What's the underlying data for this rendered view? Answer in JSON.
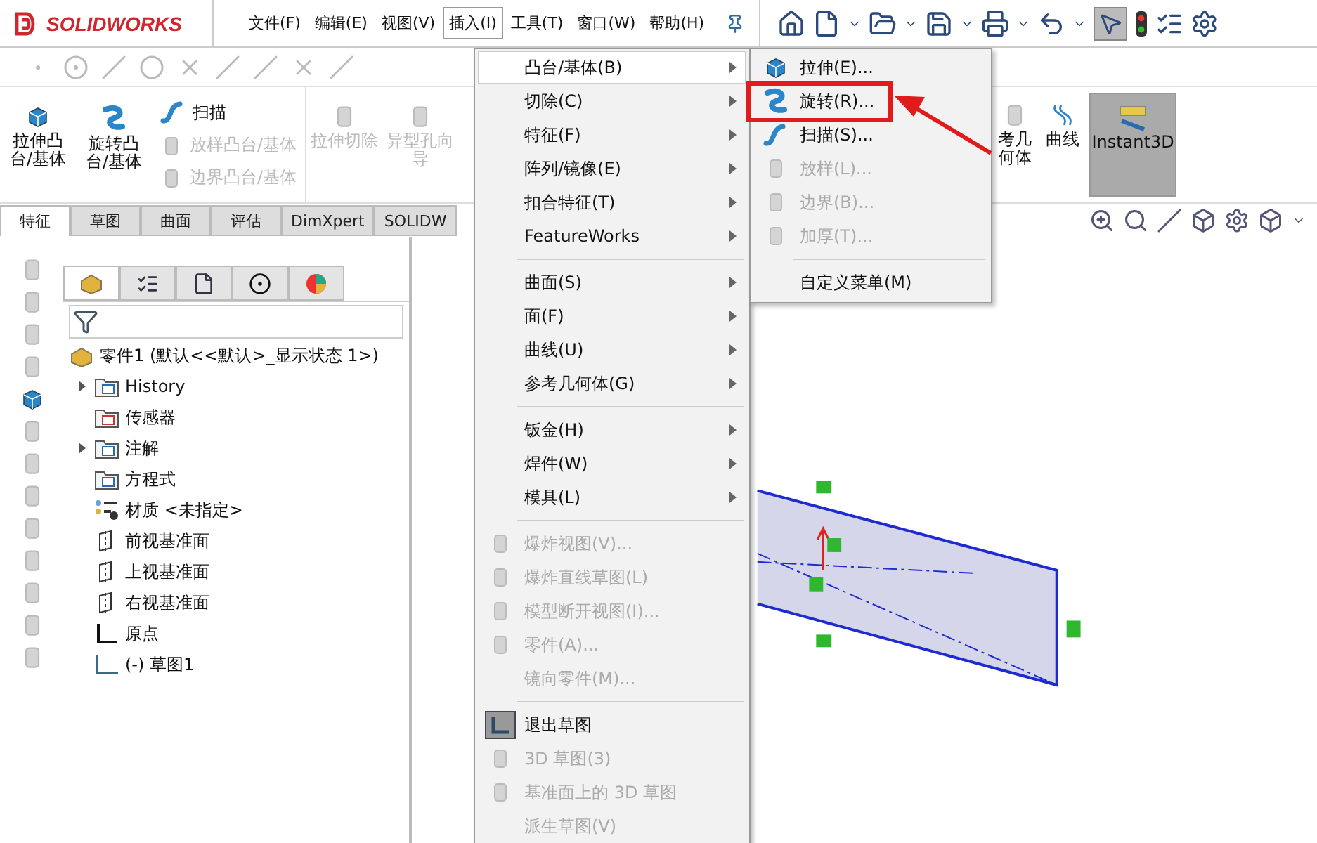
{
  "app": {
    "logo": "SOLIDWORKS"
  },
  "menubar": [
    {
      "label": "文件(F)",
      "selected": false
    },
    {
      "label": "编辑(E)",
      "selected": false
    },
    {
      "label": "视图(V)",
      "selected": false
    },
    {
      "label": "插入(I)",
      "selected": true
    },
    {
      "label": "工具(T)",
      "selected": false
    },
    {
      "label": "窗口(W)",
      "selected": false
    },
    {
      "label": "帮助(H)",
      "selected": false
    }
  ],
  "ribbon": {
    "large": [
      {
        "label": "拉伸凸台/基体",
        "disabled": false
      },
      {
        "label": "旋转凸台/基体",
        "disabled": false
      }
    ],
    "small": [
      {
        "label": "扫描",
        "disabled": false
      },
      {
        "label": "放样凸台/基体",
        "disabled": true
      },
      {
        "label": "边界凸台/基体",
        "disabled": true
      }
    ],
    "cut": [
      {
        "label": "拉伸切除",
        "disabled": true
      },
      {
        "label": "异型孔向导",
        "disabled": true
      }
    ],
    "right": [
      {
        "label": "考几何体",
        "selected": false
      },
      {
        "label": "曲线",
        "selected": false
      },
      {
        "label": "Instant3D",
        "selected": true
      }
    ]
  },
  "tabs": [
    {
      "label": "特征",
      "selected": true
    },
    {
      "label": "草图",
      "selected": false
    },
    {
      "label": "曲面",
      "selected": false
    },
    {
      "label": "评估",
      "selected": false
    },
    {
      "label": "DimXpert",
      "selected": false
    },
    {
      "label": "SOLIDW",
      "selected": false
    }
  ],
  "panel_tabs": [
    {
      "selected": true
    },
    {
      "selected": false
    },
    {
      "selected": false
    },
    {
      "selected": false
    },
    {
      "selected": false
    }
  ],
  "tree": {
    "root": "零件1  (默认<<默认>_显示状态 1>)",
    "items": [
      {
        "label": "History",
        "kind": "history",
        "expandable": true
      },
      {
        "label": "传感器",
        "kind": "sensor",
        "expandable": false
      },
      {
        "label": "注解",
        "kind": "annotation",
        "expandable": true
      },
      {
        "label": "方程式",
        "kind": "equation",
        "expandable": false
      },
      {
        "label": "材质 <未指定>",
        "kind": "material",
        "expandable": false
      },
      {
        "label": "前视基准面",
        "kind": "plane",
        "expandable": false
      },
      {
        "label": "上视基准面",
        "kind": "plane",
        "expandable": false
      },
      {
        "label": "右视基准面",
        "kind": "plane",
        "expandable": false
      },
      {
        "label": "原点",
        "kind": "origin",
        "expandable": false
      },
      {
        "label": "(-) 草图1",
        "kind": "sketch",
        "expandable": false
      }
    ]
  },
  "insert_menu": {
    "items": [
      {
        "kind": "submenu",
        "label": "凸台/基体(B)",
        "selected": true,
        "disabled": false
      },
      {
        "kind": "submenu",
        "label": "切除(C)",
        "selected": false,
        "disabled": false
      },
      {
        "kind": "submenu",
        "label": "特征(F)",
        "selected": false,
        "disabled": false
      },
      {
        "kind": "submenu",
        "label": "阵列/镜像(E)",
        "selected": false,
        "disabled": false
      },
      {
        "kind": "submenu",
        "label": "扣合特征(T)",
        "selected": false,
        "disabled": false
      },
      {
        "kind": "submenu",
        "label": "FeatureWorks",
        "selected": false,
        "disabled": false
      },
      {
        "kind": "separator"
      },
      {
        "kind": "submenu",
        "label": "曲面(S)",
        "selected": false,
        "disabled": false
      },
      {
        "kind": "submenu",
        "label": "面(F)",
        "selected": false,
        "disabled": false
      },
      {
        "kind": "submenu",
        "label": "曲线(U)",
        "selected": false,
        "disabled": false
      },
      {
        "kind": "submenu",
        "label": "参考几何体(G)",
        "selected": false,
        "disabled": false
      },
      {
        "kind": "separator"
      },
      {
        "kind": "submenu",
        "label": "钣金(H)",
        "selected": false,
        "disabled": false
      },
      {
        "kind": "submenu",
        "label": "焊件(W)",
        "selected": false,
        "disabled": false
      },
      {
        "kind": "submenu",
        "label": "模具(L)",
        "selected": false,
        "disabled": false
      },
      {
        "kind": "separator"
      },
      {
        "kind": "command",
        "label": "爆炸视图(V)...",
        "selected": false,
        "disabled": true
      },
      {
        "kind": "command",
        "label": "爆炸直线草图(L)",
        "selected": false,
        "disabled": true
      },
      {
        "kind": "command",
        "label": "模型断开视图(I)...",
        "selected": false,
        "disabled": true
      },
      {
        "kind": "command",
        "label": "零件(A)...",
        "selected": false,
        "disabled": true
      },
      {
        "kind": "command",
        "label": "镜向零件(M)...",
        "selected": false,
        "disabled": true
      },
      {
        "kind": "separator"
      },
      {
        "kind": "command",
        "label": "退出草图",
        "selected": false,
        "disabled": false
      },
      {
        "kind": "command",
        "label": "3D 草图(3)",
        "selected": false,
        "disabled": true
      },
      {
        "kind": "command",
        "label": "基准面上的 3D 草图",
        "selected": false,
        "disabled": true
      },
      {
        "kind": "command",
        "label": "派生草图(V)",
        "selected": false,
        "disabled": true
      }
    ]
  },
  "submenu": {
    "items": [
      {
        "kind": "command",
        "label": "拉伸(E)...",
        "disabled": false,
        "boxed": false
      },
      {
        "kind": "command",
        "label": "旋转(R)...",
        "disabled": false,
        "boxed": true
      },
      {
        "kind": "command",
        "label": "扫描(S)...",
        "disabled": false,
        "boxed": false
      },
      {
        "kind": "command",
        "label": "放样(L)...",
        "disabled": true,
        "boxed": false
      },
      {
        "kind": "command",
        "label": "边界(B)...",
        "disabled": true,
        "boxed": false
      },
      {
        "kind": "command",
        "label": "加厚(T)...",
        "disabled": true,
        "boxed": false
      },
      {
        "kind": "separator"
      },
      {
        "kind": "command",
        "label": "自定义菜单(M)",
        "disabled": false,
        "boxed": false
      }
    ]
  }
}
